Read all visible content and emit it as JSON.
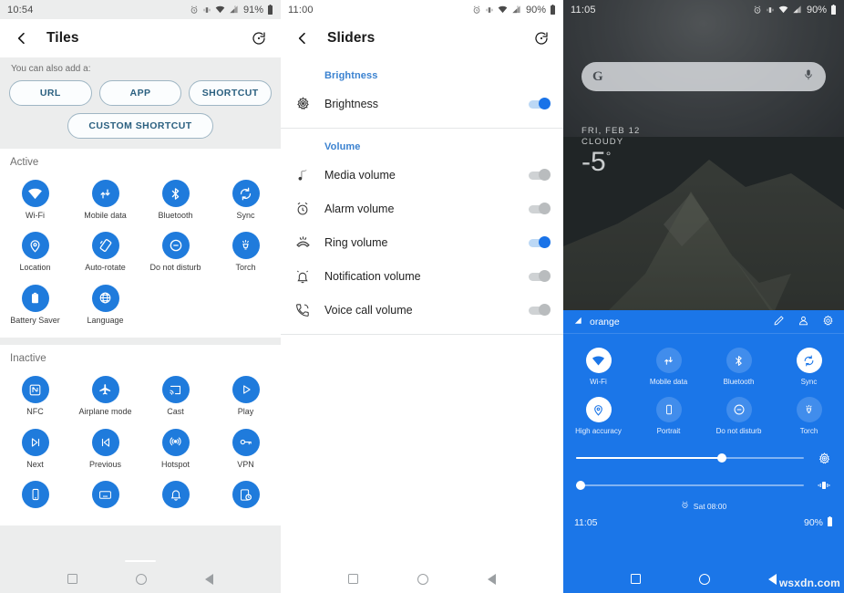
{
  "panel1": {
    "status": {
      "time": "10:54",
      "battery": "91%",
      "icons": [
        "alarm-icon",
        "vibrate-icon",
        "wifi-icon",
        "signal-icon",
        "battery-icon"
      ]
    },
    "appbar": {
      "title": "Tiles",
      "back_icon": "back-arrow-icon",
      "action_icon": "restore-icon"
    },
    "add": {
      "hint": "You can also add a:",
      "buttons": [
        "URL",
        "APP",
        "SHORTCUT"
      ],
      "custom": "CUSTOM SHORTCUT"
    },
    "active": {
      "heading": "Active",
      "tiles": [
        {
          "label": "Wi-Fi",
          "icon": "wifi-icon"
        },
        {
          "label": "Mobile data",
          "icon": "mobile-data-icon"
        },
        {
          "label": "Bluetooth",
          "icon": "bluetooth-icon"
        },
        {
          "label": "Sync",
          "icon": "sync-icon"
        },
        {
          "label": "Location",
          "icon": "location-pin-icon"
        },
        {
          "label": "Auto-rotate",
          "icon": "auto-rotate-icon"
        },
        {
          "label": "Do not disturb",
          "icon": "do-not-disturb-icon"
        },
        {
          "label": "Torch",
          "icon": "torch-icon"
        },
        {
          "label": "Battery Saver",
          "icon": "battery-icon"
        },
        {
          "label": "Language",
          "icon": "globe-icon"
        }
      ]
    },
    "inactive": {
      "heading": "Inactive",
      "tiles": [
        {
          "label": "NFC",
          "icon": "nfc-icon"
        },
        {
          "label": "Airplane mode",
          "icon": "airplane-icon"
        },
        {
          "label": "Cast",
          "icon": "cast-icon"
        },
        {
          "label": "Play",
          "icon": "play-icon"
        },
        {
          "label": "Next",
          "icon": "next-track-icon"
        },
        {
          "label": "Previous",
          "icon": "previous-track-icon"
        },
        {
          "label": "Hotspot",
          "icon": "hotspot-icon"
        },
        {
          "label": "VPN",
          "icon": "vpn-key-icon"
        },
        {
          "label": "",
          "icon": "phone-icon"
        },
        {
          "label": "",
          "icon": "keyboard-icon"
        },
        {
          "label": "",
          "icon": "bell-icon"
        },
        {
          "label": "",
          "icon": "screen-timeout-icon"
        }
      ]
    },
    "nav": [
      "recents-icon",
      "home-icon",
      "back-icon"
    ]
  },
  "panel2": {
    "status": {
      "time": "11:00",
      "battery": "90%"
    },
    "appbar": {
      "title": "Sliders",
      "back_icon": "back-arrow-icon",
      "action_icon": "restore-icon"
    },
    "groups": [
      {
        "heading": "Brightness",
        "rows": [
          {
            "label": "Brightness",
            "icon": "brightness-icon",
            "on": true
          }
        ]
      },
      {
        "heading": "Volume",
        "rows": [
          {
            "label": "Media volume",
            "icon": "music-note-icon",
            "on": false
          },
          {
            "label": "Alarm volume",
            "icon": "alarm-clock-icon",
            "on": false
          },
          {
            "label": "Ring volume",
            "icon": "ring-volume-icon",
            "on": true
          },
          {
            "label": "Notification volume",
            "icon": "notification-bell-icon",
            "on": false
          },
          {
            "label": "Voice call volume",
            "icon": "phone-call-icon",
            "on": false
          }
        ]
      }
    ],
    "nav": [
      "recents-icon",
      "home-icon",
      "back-icon"
    ]
  },
  "panel3": {
    "status": {
      "time": "11:05",
      "battery": "90%"
    },
    "search": {
      "logo": "G",
      "mic_icon": "microphone-icon"
    },
    "weather": {
      "date": "FRI, FEB 12",
      "condition": "CLOUDY",
      "temp": "-5",
      "unit": "°"
    },
    "qs": {
      "carrier": "orange",
      "signal_icon": "signal-triangle-icon",
      "header_icons": [
        "edit-pencil-icon",
        "user-account-icon",
        "settings-gear-icon"
      ],
      "tiles": [
        {
          "label": "Wi-Fi",
          "icon": "wifi-icon",
          "on": true
        },
        {
          "label": "Mobile data",
          "icon": "mobile-data-icon",
          "on": false
        },
        {
          "label": "Bluetooth",
          "icon": "bluetooth-icon",
          "on": false
        },
        {
          "label": "Sync",
          "icon": "sync-icon",
          "on": true
        },
        {
          "label": "High accuracy",
          "icon": "location-pin-icon",
          "on": true
        },
        {
          "label": "Portrait",
          "icon": "portrait-icon",
          "on": false
        },
        {
          "label": "Do not disturb",
          "icon": "do-not-disturb-icon",
          "on": false
        },
        {
          "label": "Torch",
          "icon": "torch-icon",
          "on": false
        }
      ],
      "sliders": [
        {
          "name": "brightness",
          "value": 64,
          "icon": "brightness-icon"
        },
        {
          "name": "ring-volume",
          "value": 2,
          "icon": "vibrate-icon"
        }
      ],
      "alarm": {
        "icon": "alarm-clock-icon",
        "text": "Sat 08:00"
      },
      "footer": {
        "time": "11:05",
        "battery": "90%"
      }
    },
    "nav": [
      "recents-icon",
      "home-icon",
      "back-icon"
    ]
  },
  "watermark": "wsxdn.com",
  "colors": {
    "tile_blue": "#1f7bdc",
    "qs_blue": "#1b76e8",
    "accent_text": "#3b82d0",
    "chip_border": "#9fb6c4",
    "chip_text": "#2b6080",
    "toggle_on": "#1a73e8",
    "panel_bg": "#eceded"
  }
}
